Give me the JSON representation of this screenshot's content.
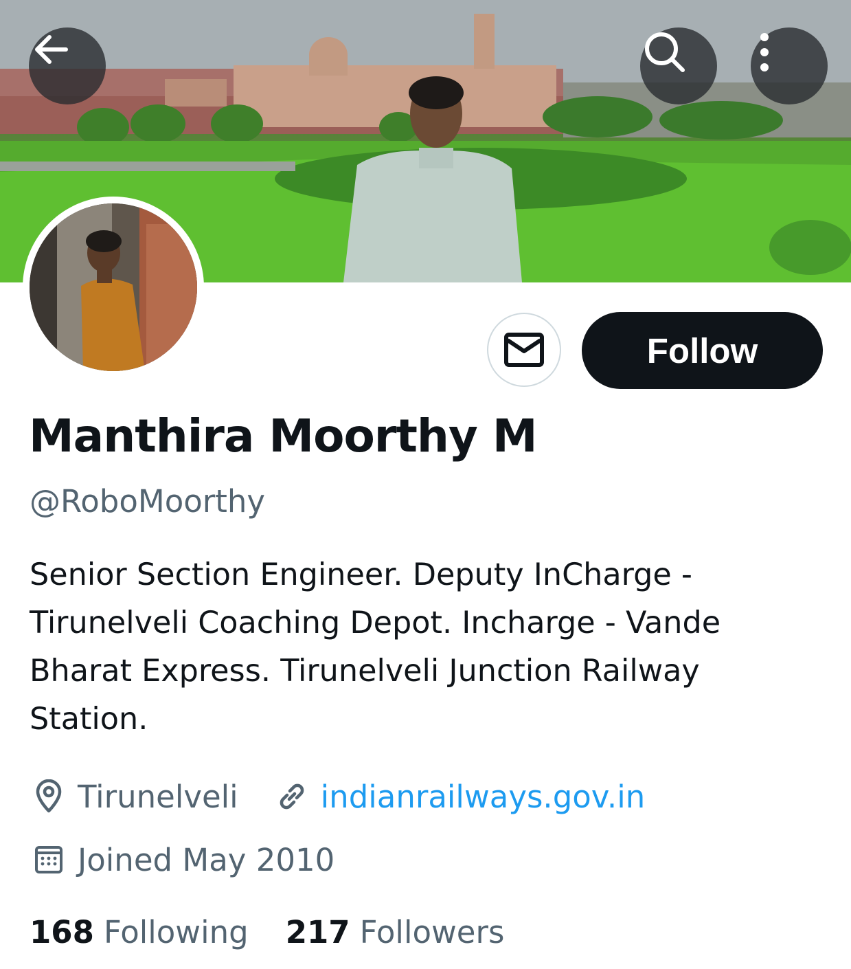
{
  "header": {
    "back_icon": "arrow-left-icon",
    "search_icon": "search-icon",
    "more_icon": "more-vertical-icon"
  },
  "profile": {
    "display_name": "Manthira Moorthy M",
    "handle": "@RoboMoorthy",
    "bio": "Senior Section Engineer.  Deputy InCharge -\nTirunelveli Coaching Depot. Incharge - Vande\nBharat  Express. Tirunelveli Junction Railway\nStation.",
    "location": "Tirunelveli",
    "website": "indianrailways.gov.in",
    "joined": "Joined May 2010"
  },
  "actions": {
    "message_icon": "envelope-icon",
    "follow_label": "Follow"
  },
  "stats": {
    "following_count": "168",
    "following_label": "Following",
    "followers_count": "217",
    "followers_label": "Followers"
  },
  "colors": {
    "text_primary": "#0f1419",
    "text_secondary": "#536471",
    "link": "#1d9bf0",
    "button_dark": "#0f1419"
  }
}
